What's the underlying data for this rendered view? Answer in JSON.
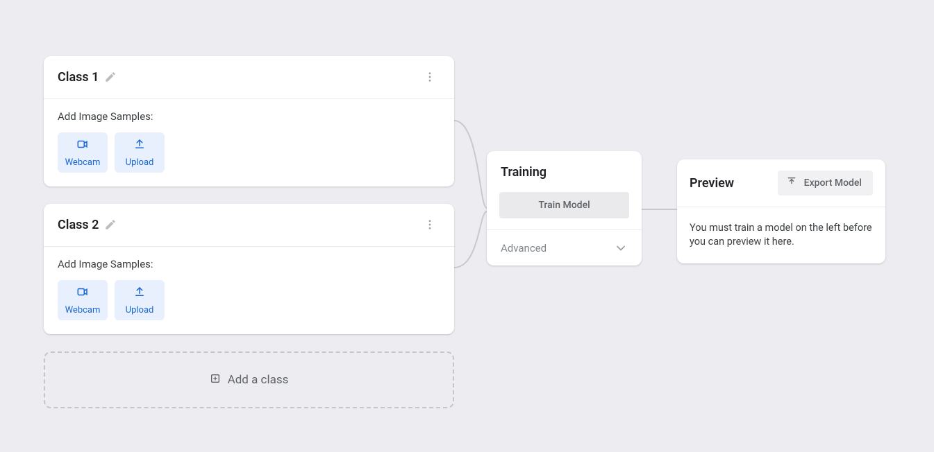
{
  "classes": [
    {
      "title": "Class 1",
      "samples_label": "Add Image Samples:",
      "chips": {
        "webcam": "Webcam",
        "upload": "Upload"
      }
    },
    {
      "title": "Class 2",
      "samples_label": "Add Image Samples:",
      "chips": {
        "webcam": "Webcam",
        "upload": "Upload"
      }
    }
  ],
  "add_class_label": "Add a class",
  "training": {
    "title": "Training",
    "train_button": "Train Model",
    "advanced_label": "Advanced"
  },
  "preview": {
    "title": "Preview",
    "export_button": "Export Model",
    "body": "You must train a model on the left before you can preview it here."
  }
}
